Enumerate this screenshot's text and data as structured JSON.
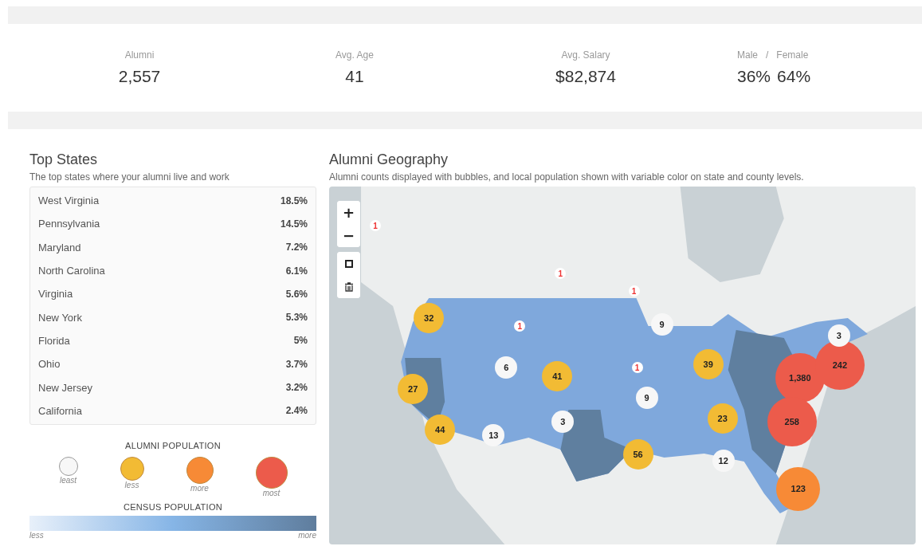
{
  "stats": [
    {
      "label": "Alumni",
      "value": "2,557"
    },
    {
      "label": "Avg. Age",
      "value": "41"
    },
    {
      "label": "Avg. Salary",
      "value": "$82,874"
    }
  ],
  "gender": {
    "labels": [
      "Male",
      "/",
      "Female"
    ],
    "values": [
      "36%",
      "64%"
    ]
  },
  "top_states": {
    "title": "Top States",
    "subtitle": "The top states where your alumni live and work",
    "rows": [
      {
        "state": "West Virginia",
        "share": "18.5%"
      },
      {
        "state": "Pennsylvania",
        "share": "14.5%"
      },
      {
        "state": "Maryland",
        "share": "7.2%"
      },
      {
        "state": "North Carolina",
        "share": "6.1%"
      },
      {
        "state": "Virginia",
        "share": "5.6%"
      },
      {
        "state": "New York",
        "share": "5.3%"
      },
      {
        "state": "Florida",
        "share": "5%"
      },
      {
        "state": "Ohio",
        "share": "3.7%"
      },
      {
        "state": "New Jersey",
        "share": "3.2%"
      },
      {
        "state": "California",
        "share": "2.4%"
      }
    ]
  },
  "legend": {
    "alumni_title": "ALUMNI POPULATION",
    "alumni_items": [
      {
        "kind": "least",
        "label": "least"
      },
      {
        "kind": "less",
        "label": "less"
      },
      {
        "kind": "more",
        "label": "more"
      },
      {
        "kind": "most",
        "label": "most"
      }
    ],
    "census_title": "CENSUS POPULATION",
    "census_low": "less",
    "census_high": "more"
  },
  "geography": {
    "title": "Alumni Geography",
    "subtitle": "Alumni counts displayed with bubbles, and local population shown with variable color on state and county levels.",
    "bubbles": [
      {
        "kind": "less",
        "count": "32"
      },
      {
        "kind": "less",
        "count": "27"
      },
      {
        "kind": "less",
        "count": "44"
      },
      {
        "kind": "least",
        "count": "6"
      },
      {
        "kind": "less",
        "count": "41"
      },
      {
        "kind": "least",
        "count": "13"
      },
      {
        "kind": "least",
        "count": "3"
      },
      {
        "kind": "less",
        "count": "56"
      },
      {
        "kind": "least",
        "count": "9"
      },
      {
        "kind": "least",
        "count": "9"
      },
      {
        "kind": "less",
        "count": "39"
      },
      {
        "kind": "less",
        "count": "23"
      },
      {
        "kind": "least",
        "count": "12"
      },
      {
        "kind": "most",
        "count": "1,380"
      },
      {
        "kind": "most",
        "count": "242"
      },
      {
        "kind": "most",
        "count": "258"
      },
      {
        "kind": "more",
        "count": "123"
      },
      {
        "kind": "least",
        "count": "3"
      },
      {
        "kind": "single",
        "count": "1"
      },
      {
        "kind": "single",
        "count": "1"
      },
      {
        "kind": "single",
        "count": "1"
      },
      {
        "kind": "single",
        "count": "1"
      },
      {
        "kind": "single",
        "count": "1"
      }
    ],
    "controls": [
      {
        "kind": "zoom-in",
        "label": "+"
      },
      {
        "kind": "zoom-out",
        "label": "−"
      },
      {
        "kind": "draw"
      },
      {
        "kind": "trash"
      }
    ]
  }
}
